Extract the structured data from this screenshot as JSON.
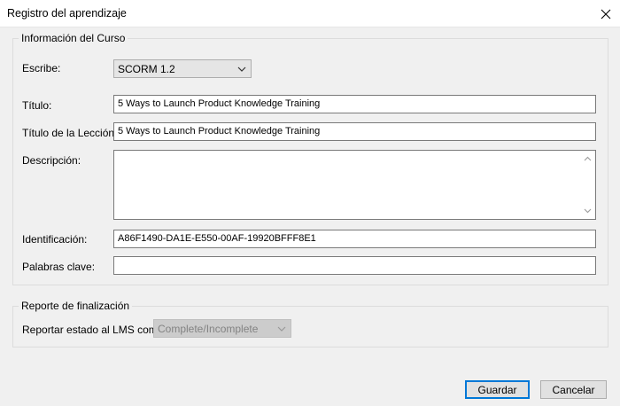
{
  "window": {
    "title": "Registro del aprendizaje"
  },
  "course_info": {
    "legend": "Información del Curso",
    "type_label": "Escribe:",
    "type_value": "SCORM 1.2",
    "title_label": "Título:",
    "title_value": "5 Ways to Launch Product Knowledge Training",
    "lesson_title_label": "Título de la Lección:",
    "lesson_title_value": "5 Ways to Launch Product Knowledge Training",
    "description_label": "Descripción:",
    "description_value": "",
    "id_label": "Identificación:",
    "id_value": "A86F1490-DA1E-E550-00AF-19920BFFF8E1",
    "keywords_label": "Palabras clave:",
    "keywords_value": ""
  },
  "completion": {
    "legend": "Reporte de finalización",
    "report_label": "Reportar estado al LMS como:",
    "report_value": "Complete/Incomplete"
  },
  "footer": {
    "save_label": "Guardar",
    "cancel_label": "Cancelar"
  },
  "colors": {
    "dialog_bg": "#f0f0f0",
    "accent": "#0078d7",
    "disabled_bg": "#cccccc"
  }
}
